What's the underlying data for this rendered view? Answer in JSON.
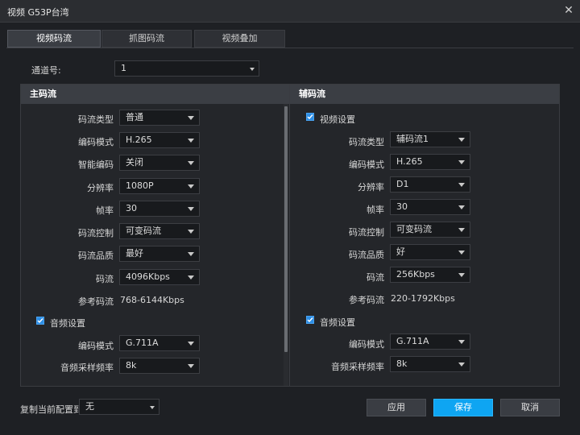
{
  "window": {
    "title": "视频 G53P台湾",
    "close": "✕"
  },
  "tabs": [
    "视频码流",
    "抓图码流",
    "视频叠加"
  ],
  "channel": {
    "label": "通道号:",
    "value": "1"
  },
  "main_stream": {
    "header": "主码流",
    "fields": [
      {
        "label": "码流类型",
        "value": "普通"
      },
      {
        "label": "编码模式",
        "value": "H.265"
      },
      {
        "label": "智能编码",
        "value": "关闭"
      },
      {
        "label": "分辨率",
        "value": "1080P"
      },
      {
        "label": "帧率",
        "value": "30"
      },
      {
        "label": "码流控制",
        "value": "可变码流"
      },
      {
        "label": "码流品质",
        "value": "最好"
      },
      {
        "label": "码流",
        "value": "4096Kbps"
      }
    ],
    "ref_label": "参考码流",
    "ref_value": "768-6144Kbps",
    "audio": {
      "label": "音频设置",
      "fields": [
        {
          "label": "编码模式",
          "value": "G.711A"
        },
        {
          "label": "音频采样频率",
          "value": "8k"
        }
      ]
    }
  },
  "sub_stream": {
    "header": "辅码流",
    "video_label": "视频设置",
    "fields": [
      {
        "label": "码流类型",
        "value": "辅码流1"
      },
      {
        "label": "编码模式",
        "value": "H.265"
      },
      {
        "label": "分辨率",
        "value": "D1"
      },
      {
        "label": "帧率",
        "value": "30"
      },
      {
        "label": "码流控制",
        "value": "可变码流"
      },
      {
        "label": "码流品质",
        "value": "好"
      },
      {
        "label": "码流",
        "value": "256Kbps"
      }
    ],
    "ref_label": "参考码流",
    "ref_value": "220-1792Kbps",
    "audio": {
      "label": "音频设置",
      "fields": [
        {
          "label": "编码模式",
          "value": "G.711A"
        },
        {
          "label": "音频采样频率",
          "value": "8k"
        }
      ]
    }
  },
  "footer": {
    "copy_label": "复制当前配置到",
    "copy_value": "无",
    "apply": "应用",
    "save": "保存",
    "cancel": "取消"
  },
  "colors": {
    "accent": "#0ea5f2",
    "checkbox": "#2d8ee6",
    "panel_header": "#3b3e44",
    "background": "#1e2024"
  }
}
